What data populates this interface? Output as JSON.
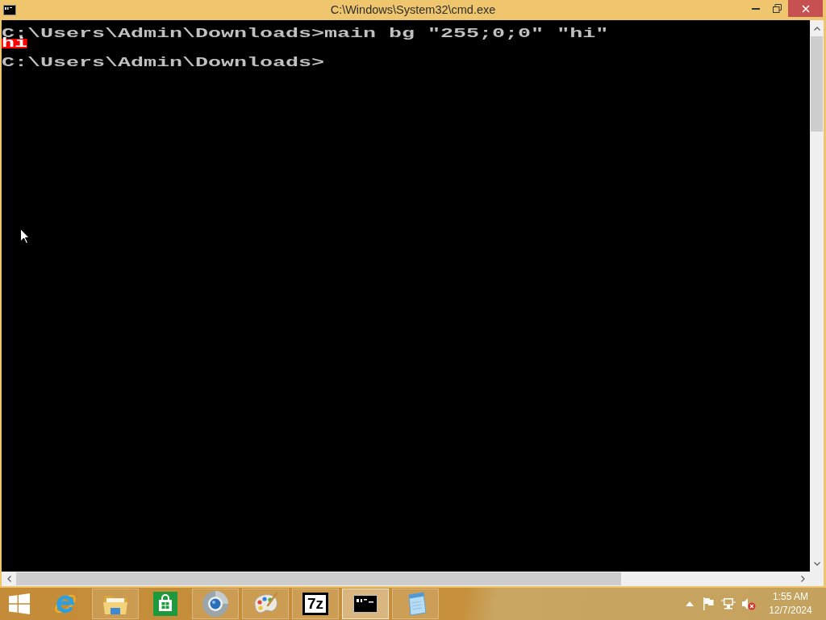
{
  "window": {
    "title": "C:\\Windows\\System32\\cmd.exe"
  },
  "console": {
    "lines": [
      {
        "kind": "line",
        "text": "C:\\Users\\Admin\\Downloads>main bg \"255;0;0\" \"hi\""
      },
      {
        "kind": "line",
        "text": "hi",
        "color": "#ff0000"
      },
      {
        "kind": "blank"
      },
      {
        "kind": "line",
        "text": "C:\\Users\\Admin\\Downloads>"
      }
    ]
  },
  "taskbar": {
    "apps": [
      {
        "kind": "browser",
        "running": false,
        "selected": false
      },
      {
        "kind": "files",
        "running": true,
        "selected": false
      },
      {
        "kind": "store",
        "running": false,
        "selected": false
      },
      {
        "kind": "orb",
        "running": true,
        "selected": false
      },
      {
        "kind": "paint",
        "running": true,
        "selected": false
      },
      {
        "kind": "archive",
        "label": "7z",
        "running": true,
        "selected": false
      },
      {
        "kind": "console",
        "running": true,
        "selected": true
      },
      {
        "kind": "notepad",
        "running": true,
        "selected": false
      }
    ],
    "tray": {
      "volume_muted": true,
      "time": "1:55 AM",
      "date": "12/7/2024"
    }
  }
}
